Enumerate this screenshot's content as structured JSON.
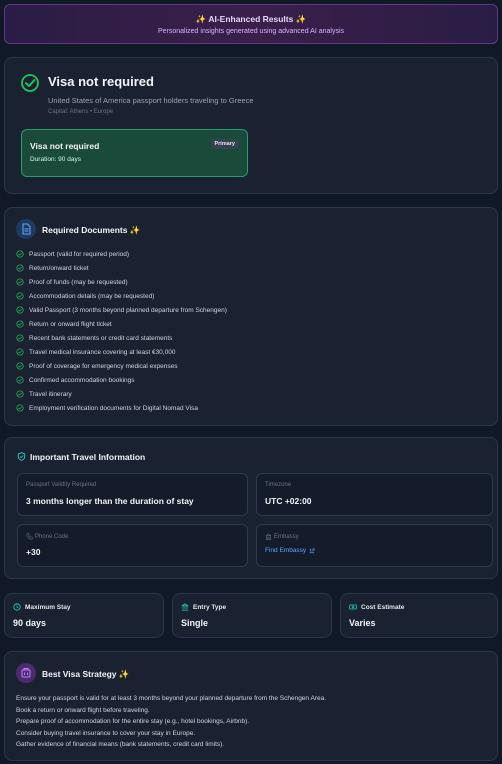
{
  "banner": {
    "spark": "✨",
    "title": "AI-Enhanced Results",
    "subtitle": "Personalized insights generated using advanced AI analysis"
  },
  "visa": {
    "status": "Visa not required",
    "description": "United States of America passport holders traveling to Greece",
    "capital": "Capital: Athens • Europe",
    "option_title": "Visa not required",
    "option_duration": "Duration: 90 days",
    "option_badge": "Primary"
  },
  "required_documents": {
    "title": "Required Documents",
    "spark": "✨",
    "items": [
      "Passport (valid for required period)",
      "Return/onward ticket",
      "Proof of funds (may be requested)",
      "Accommodation details (may be requested)",
      "Valid Passport (3 months beyond planned departure from Schengen)",
      "Return or onward flight ticket",
      "Recent bank statements or credit card statements",
      "Travel medical insurance covering at least €30,000",
      "Proof of coverage for emergency medical expenses",
      "Confirmed accommodation bookings",
      "Travel itinerary",
      "Employment verification documents for Digital Nomad Visa"
    ]
  },
  "travel_info": {
    "title": "Important Travel Information",
    "passport_validity_label": "Passport Validity Required",
    "passport_validity_value": "3 months longer than the duration of stay",
    "timezone_label": "Timezone",
    "timezone_value": "UTC +02:00",
    "phone_label": "Phone Code",
    "phone_value": "+30",
    "embassy_label": "Embassy",
    "embassy_link": "Find Embassy"
  },
  "stats": {
    "max_stay_label": "Maximum Stay",
    "max_stay_value": "90 days",
    "entry_type_label": "Entry Type",
    "entry_type_value": "Single",
    "cost_label": "Cost Estimate",
    "cost_value": "Varies"
  },
  "strategy": {
    "title": "Best Visa Strategy",
    "spark": "✨",
    "items": [
      "Ensure your passport is valid for at least 3 months beyond your planned departure from the Schengen Area.",
      "Book a return or onward flight before traveling.",
      "Prepare proof of accommodation for the entire stay (e.g., hotel bookings, Airbnb).",
      "Consider buying travel insurance to cover your stay in Europe.",
      "Gather evidence of financial means (bank statements, credit card limits)."
    ]
  },
  "colors": {
    "accent_green": "#22c55e",
    "accent_purple": "#a855f7",
    "link_blue": "#60a5fa",
    "teal": "#2dd4bf"
  },
  "icons": [
    "sparkle-icon",
    "check-circle-icon",
    "document-icon",
    "check-icon",
    "shield-icon",
    "phone-icon",
    "building-icon",
    "external-link-icon",
    "clock-icon",
    "columns-icon",
    "money-icon",
    "lightbulb-icon"
  ]
}
